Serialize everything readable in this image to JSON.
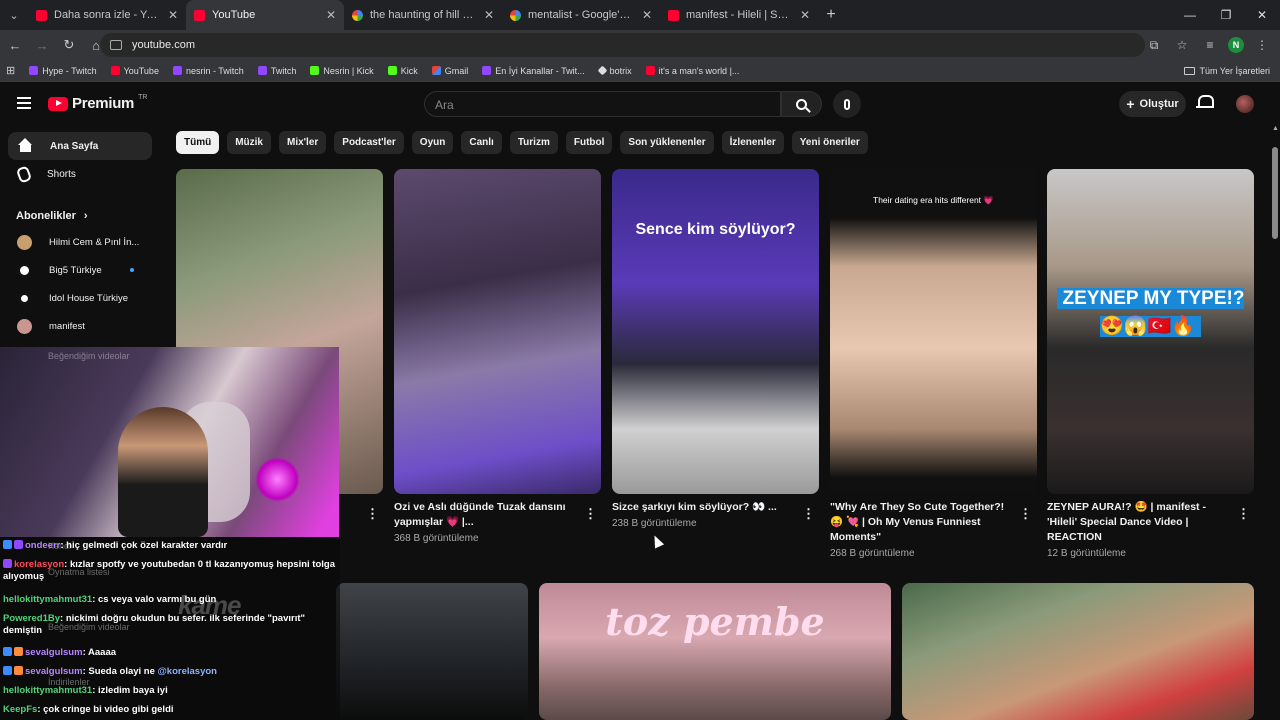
{
  "browser": {
    "tabs": [
      {
        "title": "Daha sonra izle - YouTube",
        "icon": "youtube-icon",
        "active": false
      },
      {
        "title": "YouTube",
        "icon": "youtube-icon",
        "active": true
      },
      {
        "title": "the haunting of hill house - Goo",
        "icon": "google-icon",
        "active": false
      },
      {
        "title": "mentalist - Google'da Ara",
        "icon": "google-icon",
        "active": false
      },
      {
        "title": "manifest - Hileli | Special Dance",
        "icon": "youtube-icon",
        "active": false
      }
    ],
    "url": "youtube.com",
    "profile_initial": "N",
    "bookmarks": [
      {
        "label": "Hype - Twitch",
        "icon": "twitch-icon"
      },
      {
        "label": "YouTube",
        "icon": "youtube-icon"
      },
      {
        "label": "nesrin - Twitch",
        "icon": "twitch-icon"
      },
      {
        "label": "Twitch",
        "icon": "twitch-icon"
      },
      {
        "label": "Nesrin | Kick",
        "icon": "kick-icon"
      },
      {
        "label": "Kick",
        "icon": "kick-icon"
      },
      {
        "label": "Gmail",
        "icon": "gmail-icon"
      },
      {
        "label": "En İyi Kanallar - Twit...",
        "icon": "twitch-icon"
      },
      {
        "label": "botrix",
        "icon": "botrix-icon"
      },
      {
        "label": "it's a man's world |...",
        "icon": "youtube-icon"
      }
    ],
    "all_bookmarks": "Tüm Yer İşaretleri"
  },
  "youtube": {
    "logo_text": "Premium",
    "region": "TR",
    "search_placeholder": "Ara",
    "create_label": "Oluştur",
    "sidebar": {
      "items": [
        {
          "label": "Ana Sayfa",
          "active": true
        },
        {
          "label": "Shorts",
          "active": false
        }
      ],
      "subscriptions_title": "Abonelikler",
      "subscriptions": [
        {
          "label": "Hilmi Cem & Pınl İn...",
          "color": "#c8a070"
        },
        {
          "label": "Big5 Türkiye",
          "color": "#ffffff"
        },
        {
          "label": "Idol House Türkiye",
          "color": "#ffffff"
        },
        {
          "label": "manifest",
          "color": "#c89890"
        }
      ]
    },
    "chips": [
      "Tümü",
      "Müzik",
      "Mix'ler",
      "Podcast'ler",
      "Oyun",
      "Canlı",
      "Turizm",
      "Futbol",
      "Son yüklenenler",
      "İzlenenler",
      "Yeni öneriler"
    ],
    "videos": [
      {
        "title": "",
        "views": "",
        "caption": ""
      },
      {
        "title": "Ozi ve Aslı düğünde Tuzak dansını yapmışlar 💗 |...",
        "views": "368 B görüntüleme",
        "caption": ""
      },
      {
        "title": "Sizce şarkıyı kim söylüyor? 👀 ...",
        "views": "238 B görüntüleme",
        "caption": "Sence kim söylüyor?"
      },
      {
        "title": "\"Why Are They So Cute Together?! 😝 💘 | Oh My Venus Funniest Moments\"",
        "views": "268 B görüntüleme",
        "caption": "Their dating era hits different 💗"
      },
      {
        "title": "ZEYNEP AURA!? 🤩 | manifest - 'Hileli' Special Dance Video | REACTION",
        "views": "12 B görüntüleme",
        "caption": "ZEYNEP MY TYPE!? 😍😱🇹🇷🔥"
      }
    ],
    "row2_captions": {
      "middle": "toz pembe"
    }
  },
  "overlay": {
    "ghost_texts": {
      "a": "Beğendiğim videolar",
      "b": "Oynatma listesi",
      "c": "İndirilenler",
      "d": "Kendi"
    },
    "ghost_logo": "kame",
    "chat": [
      {
        "user": "ondeerr",
        "text": ": hiç gelmedi çok özel karakter vardır",
        "color": "u-purple",
        "badges": [
          "b-blue",
          "b-purple"
        ]
      },
      {
        "user": "korelasyon",
        "text": ": kızlar spotfy ve youtubedan 0 tl kazanıyomuş hepsini tolga alıyomuş",
        "color": "u-red",
        "badges": [
          "b-purple"
        ]
      },
      {
        "user": "hellokittymahmut31",
        "text": ": cs veya valo varmı bu gün",
        "color": "u-green",
        "badges": []
      },
      {
        "user": "Powered1By",
        "text": ": nickimi doğru okudun bu sefer. ilk seferinde \"pavırıt\" demiştin",
        "color": "u-green",
        "badges": []
      },
      {
        "user": "sevalgulsum",
        "text": ": Aaaaa",
        "color": "u-purple",
        "badges": [
          "b-blue",
          "b-orange"
        ]
      },
      {
        "user": "sevalgulsum",
        "text": ": Sueda olayi ne",
        "color": "u-purple",
        "badges": [
          "b-blue",
          "b-orange"
        ],
        "mention": "@korelasyon"
      },
      {
        "user": "hellokittymahmut31",
        "text": ": izledim baya iyi",
        "color": "u-green",
        "badges": []
      },
      {
        "user": "KeepFs",
        "text": ": çok cringe bi video gibi geldi",
        "color": "u-green",
        "badges": []
      }
    ]
  }
}
